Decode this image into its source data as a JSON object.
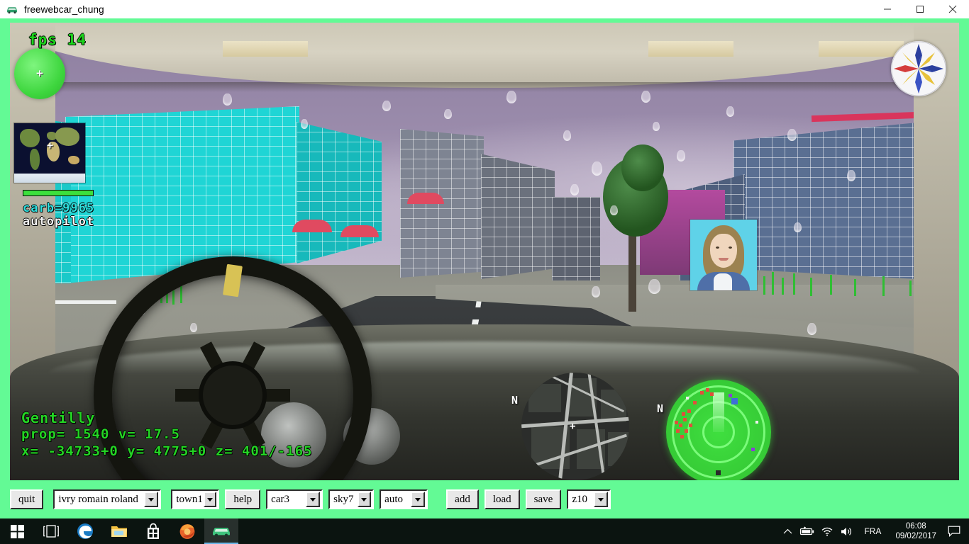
{
  "window": {
    "title": "freewebcar_chung",
    "icon": "car-icon",
    "minimize": "—",
    "maximize": "□",
    "close": "✕"
  },
  "hud": {
    "fps": "fps 14",
    "carb": "carb=9965",
    "autopilot": "autopilot",
    "place": "Gentilly",
    "prop": "prop= 1540  v= 17.5",
    "coords": "x= -34733+0  y= 4775+0  z= 401/-165",
    "fuel_percent": 100,
    "map_north_label": "N",
    "radar_north_label": "N",
    "crosshair": "+",
    "colors": {
      "fps": "#1cd41c",
      "carb": "#2fe0df",
      "autopilot": "#f2f2f2",
      "telemetry": "#24d424",
      "radar": "#3fdf3f",
      "app_background": "#63fa95"
    }
  },
  "toolbar": {
    "quit": "quit",
    "route": "ivry romain roland",
    "town": "town1",
    "help": "help",
    "car": "car3",
    "sky": "sky7",
    "mode": "auto",
    "add": "add",
    "load": "load",
    "save": "save",
    "zoom": "z10"
  },
  "taskbar": {
    "items": [
      {
        "name": "start-button",
        "icon": "windows-logo-icon"
      },
      {
        "name": "task-view-button",
        "icon": "task-view-icon"
      },
      {
        "name": "edge-button",
        "icon": "edge-icon"
      },
      {
        "name": "file-explorer-button",
        "icon": "folder-icon"
      },
      {
        "name": "store-button",
        "icon": "store-icon"
      },
      {
        "name": "firefox-button",
        "icon": "firefox-icon"
      },
      {
        "name": "freewebcar-button",
        "icon": "car-icon"
      }
    ],
    "tray": {
      "chevron": "∧",
      "battery": "battery-icon",
      "wifi": "wifi-icon",
      "volume": "volume-icon",
      "language": "FRA",
      "time": "06:08",
      "date": "09/02/2017",
      "action_center": "action-center-icon"
    }
  }
}
